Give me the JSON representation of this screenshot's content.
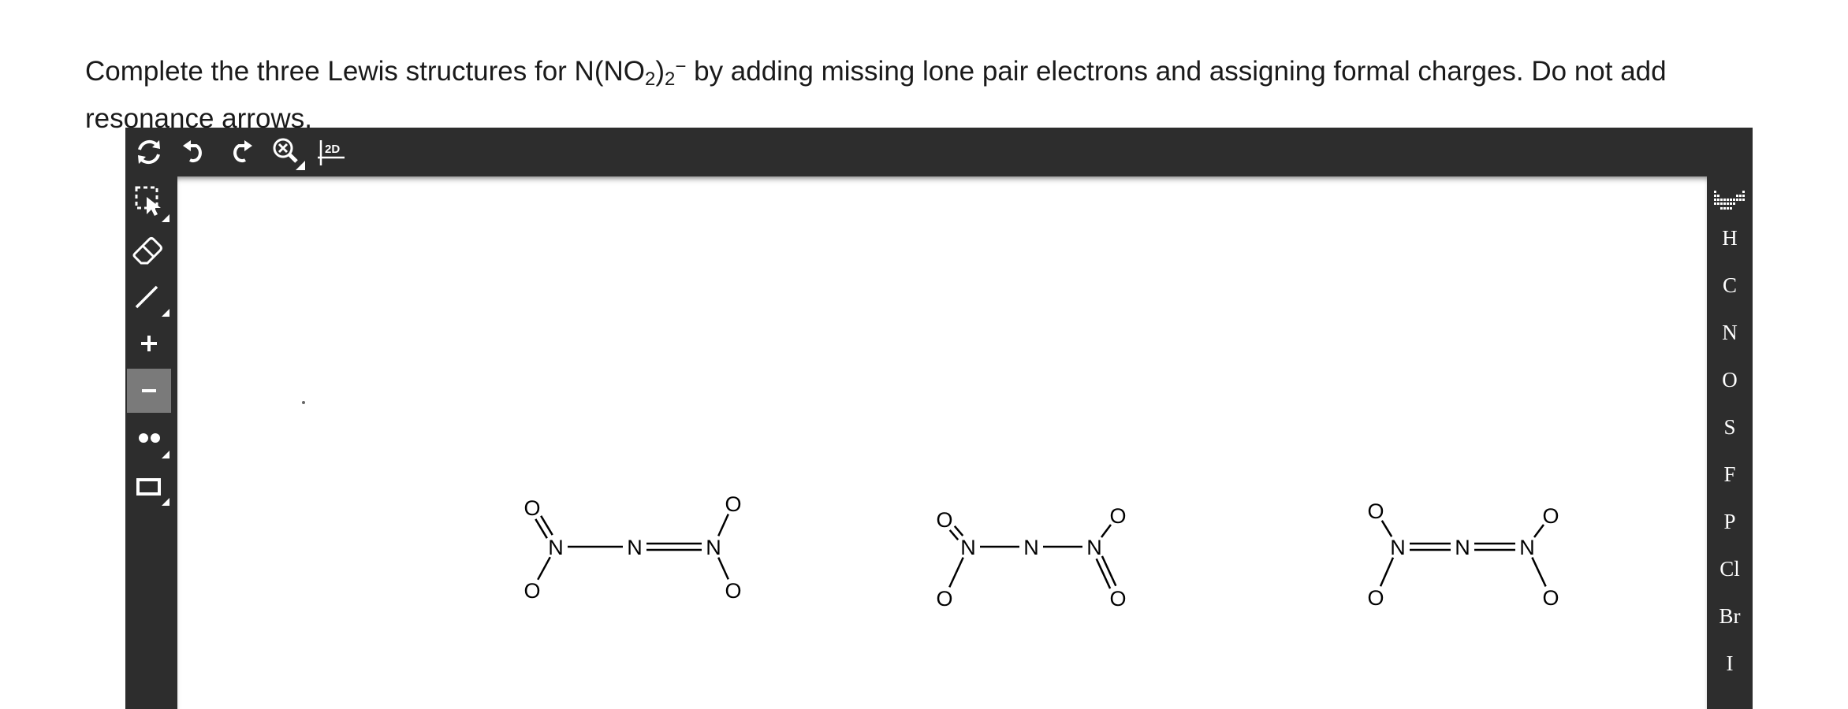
{
  "question": {
    "part1": "Complete the three Lewis structures for N(NO",
    "sub1": "2",
    "part2": ")",
    "sub2": "2",
    "sup": "−",
    "part3": " by adding missing lone pair electrons and assigning formal charges. Do not add resonance arrows."
  },
  "top_toolbar": {
    "items": [
      {
        "name": "clear-canvas-icon"
      },
      {
        "name": "undo-icon"
      },
      {
        "name": "redo-icon"
      },
      {
        "name": "zoom-icon"
      },
      {
        "name": "clean-2d-icon",
        "label": "2D"
      }
    ]
  },
  "left_toolbar": {
    "items": [
      {
        "name": "select-tool-icon"
      },
      {
        "name": "eraser-tool-icon"
      },
      {
        "name": "bond-tool-icon"
      },
      {
        "name": "positive-charge-tool",
        "label": "+"
      },
      {
        "name": "negative-charge-tool",
        "label": "−",
        "active": true
      },
      {
        "name": "lone-pair-tool-icon"
      },
      {
        "name": "shape-tool-icon"
      }
    ]
  },
  "right_toolbar": {
    "periodic_table_icon": "periodic-table-icon",
    "elements": [
      "H",
      "C",
      "N",
      "O",
      "S",
      "F",
      "P",
      "Cl",
      "Br",
      "I"
    ]
  },
  "molecules": [
    {
      "atoms": [
        "O",
        "N",
        "O",
        "N",
        "N",
        "O",
        "O"
      ],
      "bond_types": [
        "double",
        "single",
        "single",
        "double",
        "single",
        "single"
      ]
    },
    {
      "atoms": [
        "O",
        "N",
        "O",
        "N",
        "N",
        "O",
        "O"
      ],
      "bond_types": [
        "double",
        "single",
        "single",
        "single",
        "single",
        "double"
      ]
    },
    {
      "atoms": [
        "O",
        "N",
        "O",
        "N",
        "N",
        "O",
        "O"
      ],
      "bond_types": [
        "single",
        "single",
        "double",
        "double",
        "single",
        "single"
      ]
    }
  ]
}
